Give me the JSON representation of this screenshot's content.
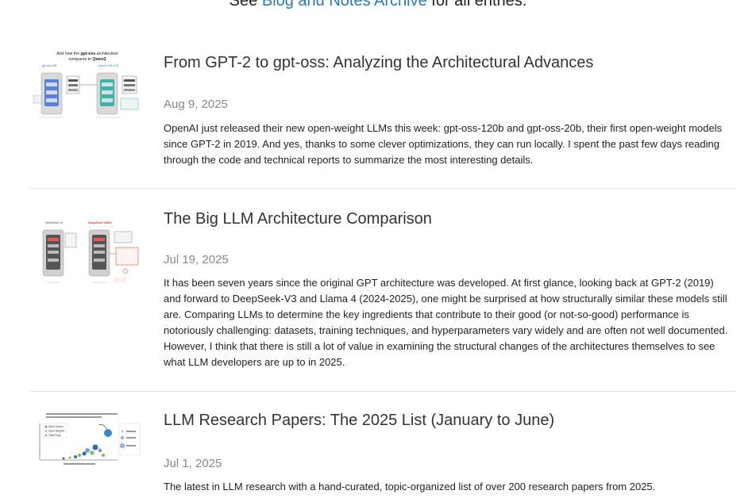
{
  "archive_line": {
    "prefix": "See ",
    "link_text": "Blog and Notes Archive",
    "suffix": " for all entries."
  },
  "posts": [
    {
      "title": "From GPT-2 to gpt-oss: Analyzing the Architectural Advances",
      "date": "Aug 9, 2025",
      "summary": "OpenAI just released their new open-weight LLMs this week: gpt-oss-120b and gpt-oss-20b, their first open-weight models since GPT-2 in 2019. And yes, thanks to some clever optimizations, they can run locally. I spent the past few days reading through the code and technical reports to summarize the most interesting details.",
      "thumb": {
        "heading_prefix": "And how the ",
        "heading_bold": "gpt-oss",
        "heading_suffix": " architecture",
        "heading_line2_prefix": "compares to ",
        "heading_line2_bold": "Qwen3",
        "left_label": "gpt-oss-20B",
        "right_label": "Qwen3 30B-A3B",
        "left_color": "#3b6fd6",
        "right_color": "#24a89a"
      }
    },
    {
      "title": "The Big LLM Architecture Comparison",
      "date": "Jul 19, 2025",
      "summary": "It has been seven years since the original GPT architecture was developed. At first glance, looking back at GPT-2 (2019) and forward to DeepSeek-V3 and Llama 4 (2024-2025), one might be surprised at how structurally similar these models still are. Comparing LLMs to determine the key ingredients that contribute to their good (or not-so-good) performance is notoriously challenging: datasets, training techniques, and hyperparameters vary widely and are often not well documented. However, I think that there is still a lot of value in examining the structural changes of the architectures themselves to see what LLM developers are up to in 2025.",
      "thumb": {
        "left_label": "DeepSeek V3",
        "right_label": "DeepSeek V3/R1",
        "right_color": "#e0321c"
      }
    },
    {
      "title": "LLM Research Papers: The 2025 List (January to June)",
      "date": "Jul 1, 2025",
      "summary": "The latest in LLM research with a hand-curated, topic-organized list of over 200 research papers from 2025.",
      "thumb": {
        "legend": [
          "Open Source",
          "Open Weights",
          "Third Party"
        ]
      }
    }
  ]
}
